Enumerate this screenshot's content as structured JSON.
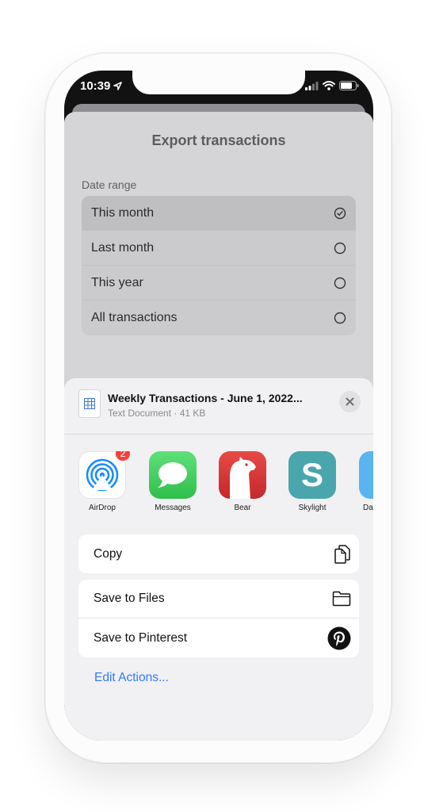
{
  "status": {
    "time": "10:39"
  },
  "sheet": {
    "title": "Export transactions",
    "section_label": "Date range",
    "options": [
      {
        "label": "This month",
        "selected": true
      },
      {
        "label": "Last month",
        "selected": false
      },
      {
        "label": "This year",
        "selected": false
      },
      {
        "label": "All transactions",
        "selected": false
      }
    ]
  },
  "share": {
    "file_title": "Weekly Transactions - June 1, 2022...",
    "file_subtitle": "Text Document · 41 KB",
    "apps": [
      {
        "label": "AirDrop",
        "badge": "2",
        "icon": "airdrop-icon",
        "color": "#1a8cff"
      },
      {
        "label": "Messages",
        "icon": "messages-icon",
        "color": "#34c759"
      },
      {
        "label": "Bear",
        "icon": "bear-icon",
        "color": "#d8373a"
      },
      {
        "label": "Skylight",
        "icon": "skylight-icon",
        "color": "#4aa6ad"
      },
      {
        "label": "Da",
        "icon": "partial-app-icon",
        "color": "#5ab4f0"
      }
    ],
    "actions_group1": [
      {
        "label": "Copy",
        "icon": "copy-icon"
      }
    ],
    "actions_group2": [
      {
        "label": "Save to Files",
        "icon": "folder-icon"
      },
      {
        "label": "Save to Pinterest",
        "icon": "pinterest-icon"
      }
    ],
    "edit_actions": "Edit Actions..."
  }
}
